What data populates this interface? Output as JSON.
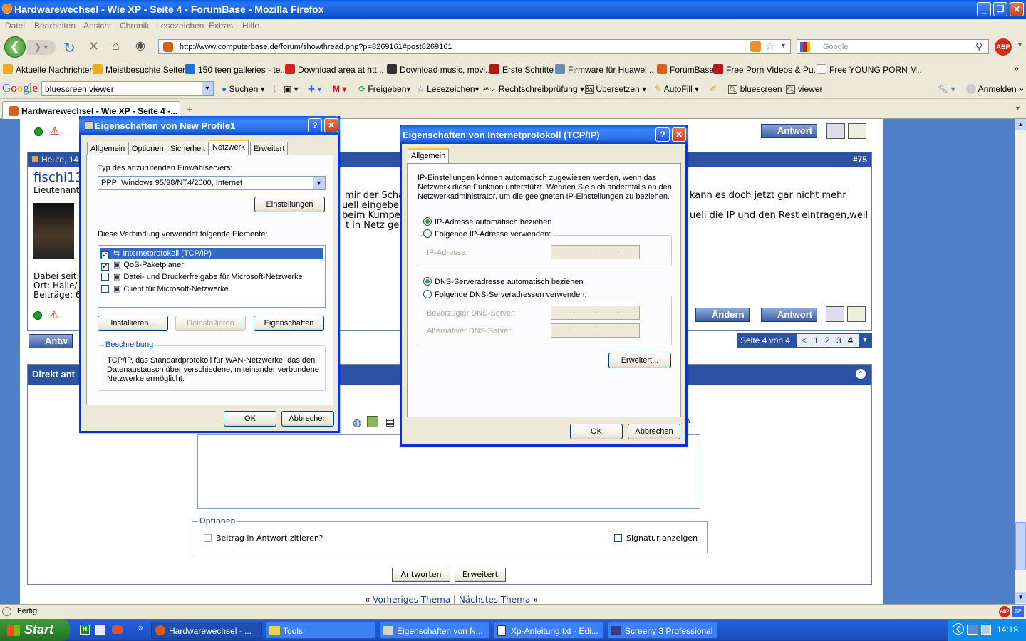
{
  "window": {
    "title": "Hardwarewechsel - Wie XP - Seite 4 - ForumBase - Mozilla Firefox"
  },
  "menu": [
    "Datei",
    "Bearbeiten",
    "Ansicht",
    "Chronik",
    "Lesezeichen",
    "Extras",
    "Hilfe"
  ],
  "nav": {
    "url": "http://www.computerbase.de/forum/showthread.php?p=8269161#post8269161",
    "search_placeholder": "Google"
  },
  "bookmarks": [
    "Aktuelle Nachrichten",
    "Meistbesuchte Seiten",
    "150 teen galleries - te...",
    "Download area at htt...",
    "Download music, movi...",
    "Erste Schritte",
    "Firmware für Huawei ...",
    "ForumBase",
    "Free Porn Videos & Pu...",
    "Free YOUNG PORN M..."
  ],
  "gbar": {
    "query": "bluescreen viewer",
    "suchen": "Suchen",
    "freigeben": "Freigeben",
    "lesezeichen": "Lesezeichen",
    "rechtschreib": "Rechtschreibprüfung",
    "uebersetzen": "Übersetzen",
    "autofill": "AutoFill",
    "term1": "bluescreen",
    "term2": "viewer",
    "anmelden": "Anmelden"
  },
  "tab": {
    "label": "Hardwarewechsel - Wie XP - Seite 4 -..."
  },
  "forum": {
    "post_date": "Heute, 14",
    "post_num": "#75",
    "user": "fischi13",
    "rank": "Lieutenant",
    "meta1": "Dabei seit:",
    "meta2": "Ort: Halle/",
    "meta3": "Beiträge: 6",
    "text1": "mir der Schäd",
    "text2": "uell eingeber",
    "text3": "beim Kumpel",
    "text4": "t in Netz gela:",
    "text5": "kann es doch jetzt gar nicht mehr",
    "text6": "uell die IP und den Rest eintragen,weil",
    "aendern": "Ändern",
    "antwort": "Antwort",
    "antw": "Antw",
    "pages": "Seite 4 von 4",
    "p1": "1",
    "p2": "2",
    "p3": "3",
    "p4": "4",
    "prev": "<",
    "direkt": "Direkt ant",
    "optionen": "Optionen",
    "zitieren": "Beitrag in Antwort zitieren?",
    "signatur": "Signatur anzeigen",
    "antworten": "Antworten",
    "erweitert": "Erweitert",
    "prev_thema": "Vorheriges Thema",
    "next_thema": "Nächstes Thema",
    "sep": "|"
  },
  "dlg1": {
    "title": "Eigenschaften von New Profile1",
    "tabs": [
      "Allgemein",
      "Optionen",
      "Sicherheit",
      "Netzwerk",
      "Erweitert"
    ],
    "typ_label": "Typ des anzurufenden Einwählservers:",
    "typ_value": "PPP: Windows 95/98/NT4/2000, Internet",
    "einstellungen": "Einstellungen",
    "elements_label": "Diese Verbindung verwendet folgende Elemente:",
    "items": [
      {
        "label": "Internetprotokoll (TCP/IP)",
        "checked": true
      },
      {
        "label": "QoS-Paketplaner",
        "checked": true
      },
      {
        "label": "Datei- und Druckerfreigabe für Microsoft-Netzwerke",
        "checked": false
      },
      {
        "label": "Client für Microsoft-Netzwerke",
        "checked": false
      }
    ],
    "installieren": "Installieren...",
    "deinstallieren": "Deinstallieren",
    "eigenschaften": "Eigenschaften",
    "beschreibung": "Beschreibung",
    "desc1": "TCP/IP, das Standardprotokoll für WAN-Netzwerke, das den",
    "desc2": "Datenaustausch über verschiedene, miteinander verbundene",
    "desc3": "Netzwerke ermöglicht.",
    "ok": "OK",
    "abbrechen": "Abbrechen"
  },
  "dlg2": {
    "title": "Eigenschaften von Internetprotokoll (TCP/IP)",
    "tab": "Allgemein",
    "info1": "IP-Einstellungen können automatisch zugewiesen werden, wenn das",
    "info2": "Netzwerk diese Funktion unterstützt. Wenden Sie sich andernfalls an den",
    "info3": "Netzwerkadministrator, um die geeigneten IP-Einstellungen zu beziehen.",
    "ip_auto": "IP-Adresse automatisch beziehen",
    "ip_manual": "Folgende IP-Adresse verwenden:",
    "ip_label": "IP-Adresse:",
    "dns_auto": "DNS-Serveradresse automatisch beziehen",
    "dns_manual": "Folgende DNS-Serveradressen verwenden:",
    "dns_pref": "Bevorzugter DNS-Server:",
    "dns_alt": "Alternativer DNS-Server:",
    "ip_dots": "...",
    "erweitert": "Erweitert...",
    "ok": "OK",
    "abbrechen": "Abbrechen"
  },
  "status": {
    "text": "Fertig"
  },
  "taskbar": {
    "start": "Start",
    "items": [
      "Hardwarewechsel - ...",
      "Tools",
      "Eigenschaften von N...",
      "Xp-Anleitung.txt - Edi...",
      "Screeny 3 Professional"
    ],
    "clock": "14:18"
  },
  "colors": {
    "xp_blue": "#0a5ee8",
    "task_green": "#2e8b2e",
    "forum_header": "#2b52a3"
  }
}
